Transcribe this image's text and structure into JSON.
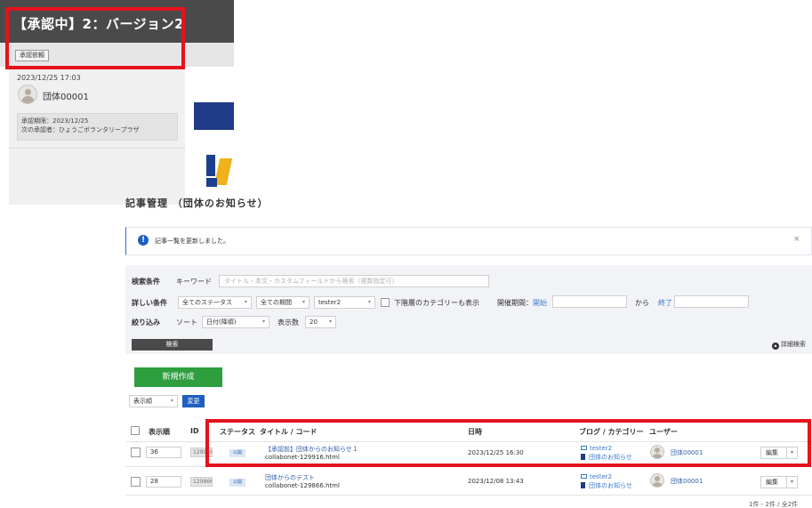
{
  "top_panel": {
    "title": "【承認中】2：バージョン2",
    "approval_request_label": "承認依頼",
    "date": "2023/12/25 17:03",
    "group_name": "団体00001",
    "approval_deadline": "承認期限：2023/12/25",
    "next_approver": "次の承認者：ひょうごボランタリープラザ"
  },
  "page_title": "記事管理 （団体のお知らせ）",
  "notice": {
    "icon": "!",
    "text": "記事一覧を更新しました。",
    "close": "×"
  },
  "search": {
    "conditions_label": "検索条件",
    "keyword_label": "キーワード",
    "keyword_placeholder": "タイトル・本文・カスタムフィールドから検索（複数指定可）",
    "detail_label": "詳しい条件",
    "status_select": "全てのステータス",
    "period_select": "全ての期間",
    "user_select": "tester2",
    "subcategory_label": "下階層のカテゴリーも表示",
    "event_period_label": "開催期間：",
    "start_label": "開始",
    "from_label": "から",
    "end_label": "終了",
    "filter_label": "絞り込み",
    "sort_label": "ソート",
    "sort_select": "日付(降順)",
    "per_page_label": "表示数",
    "per_page_select": "20",
    "search_button": "検索",
    "advanced_search": "詳細検索"
  },
  "actions": {
    "new_button": "新規作成",
    "order_select": "表示順",
    "change_button": "変更"
  },
  "table": {
    "headers": {
      "order": "表示順",
      "id": "ID",
      "status": "ステータス",
      "title": "タイトル / コード",
      "date": "日時",
      "blog": "ブログ / カテゴリー",
      "user": "ユーザー"
    },
    "rows": [
      {
        "order": "36",
        "id": "129916",
        "status": "公開",
        "title": "【承認前】団体からのお知らせ１",
        "code": "collabonet-129916.html",
        "date": "2023/12/25 16:30",
        "blog": "tester2",
        "category": "団体のお知らせ",
        "user": "団体00001",
        "edit": "編集",
        "arrow": "▾"
      },
      {
        "order": "28",
        "id": "129866",
        "status": "公開",
        "title": "団体からのテスト",
        "code": "collabonet-129866.html",
        "date": "2023/12/08 13:43",
        "blog": "tester2",
        "category": "団体のお知らせ",
        "user": "団体00001",
        "edit": "編集",
        "arrow": "▾"
      }
    ]
  },
  "pager": "1件 - 2件 / 全2件",
  "colors": {
    "highlight": "#e5121c",
    "header_bg": "#4a4a4a",
    "new_button": "#2e9e3e",
    "primary": "#1f5fbf"
  }
}
